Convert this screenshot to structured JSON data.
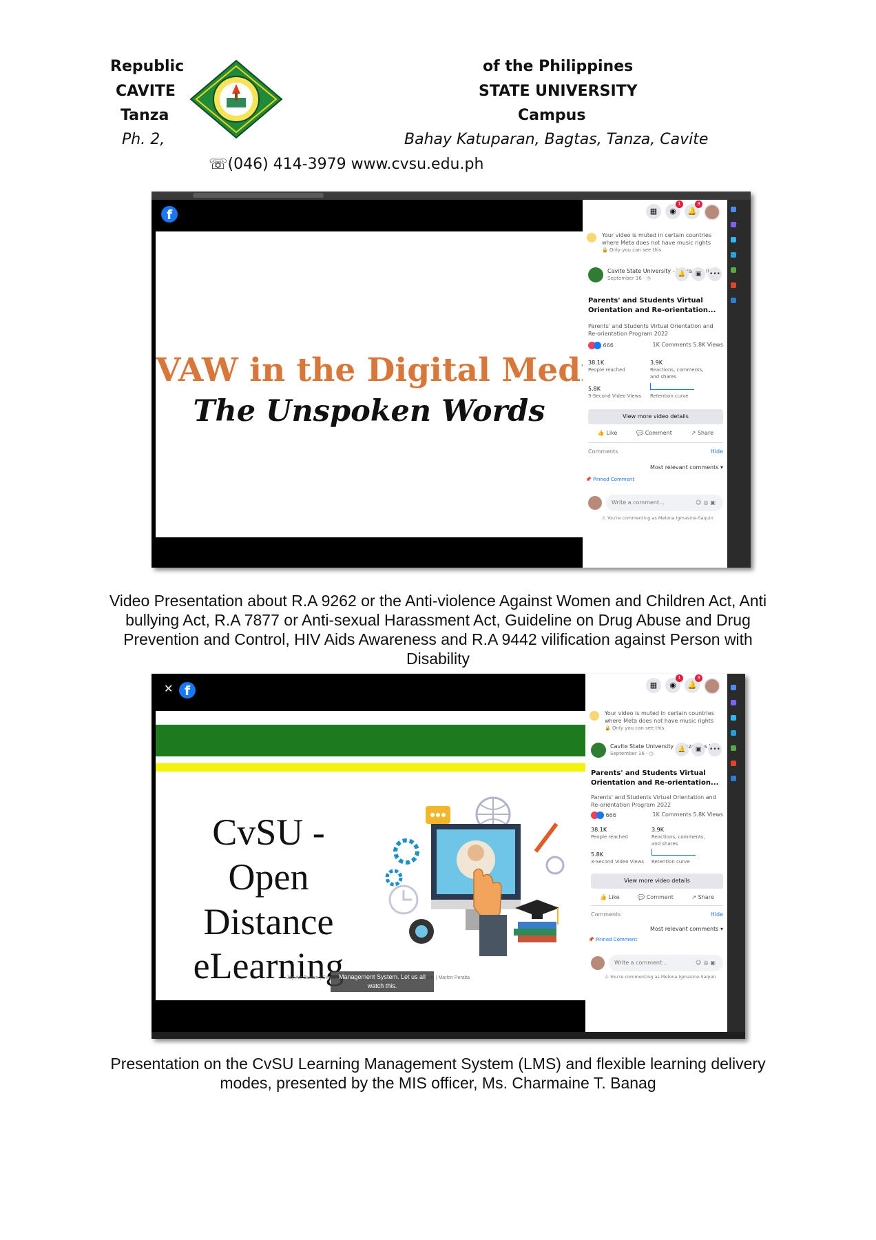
{
  "letterhead": {
    "left": [
      "Republic",
      "CAVITE",
      "Tanza",
      "Ph. 2,"
    ],
    "right": [
      "of the Philippines",
      "STATE UNIVERSITY",
      "Campus",
      "Bahay Katuparan, Bagtas, Tanza, Cavite"
    ],
    "contact": "☏(046) 414-3979 www.cvsu.edu.ph"
  },
  "colors": {
    "facebook_blue": "#1877f2",
    "vaw_orange": "#d9773a",
    "odl_green": "#1e7a1e",
    "odl_yellow": "#f2f20a",
    "seal_green": "#1f8a3a"
  },
  "fb_panel": {
    "notice": "Your video is muted in certain countries where Meta does not have music rights",
    "notice_sub": "🔒 Only you can see this",
    "page_name": "Cavite State University - Tanza was live.",
    "page_date": "September 16 · ◷",
    "title": "Parents' and Students Virtual Orientation and Re-orientation...",
    "description": "Parents' and Students Virtual Orientation and Re-orientation Program 2022",
    "reaction_count": "666",
    "comments_views": "1K Comments  5.8K Views",
    "stats": [
      {
        "value": "38.1K",
        "label": "People reached"
      },
      {
        "value": "3.9K",
        "label": "Reactions, comments, and shares"
      },
      {
        "value": "5.8K",
        "label": "3-Second Video Views"
      },
      {
        "value": "",
        "label": "Retention curve"
      }
    ],
    "view_more": "View more video details",
    "actions": [
      "👍 Like",
      "💬 Comment",
      "↗ Share"
    ],
    "comments_label": "Comments",
    "hide_label": "Hide",
    "sort_label": "Most relevant comments ▾",
    "pinned_label": "📌 Pinned Comment",
    "write_placeholder": "Write a comment...",
    "commenting_as": "⚠ You're commenting as Melona Igmasine-Saquin",
    "badge_values": [
      "1",
      "3"
    ]
  },
  "slide1": {
    "title": "VAW in the Digital Media",
    "subtitle": "The Unspoken Words"
  },
  "caption1": "Video Presentation about R.A 9262 or the Anti-violence Against Women and Children Act, Anti bullying Act, R.A 7877 or Anti-sexual Harassment Act, Guideline on Drug Abuse and Drug Prevention and Control, HIV Aids Awareness and R.A 9442 vilification against Person with Disability",
  "slide2": {
    "line1": "CvSU -",
    "line2": "Open Distance",
    "line3": "eLearning",
    "names": "Jay-Arr Buhain | Simeon Daez | Julie Ann Lontoc | Ezra Marie Ramos | Marlon Peralta",
    "subtitle_line1": "Management System. Let us all",
    "subtitle_line2": "watch this."
  },
  "caption2": "Presentation on the CvSU Learning Management System (LMS) and flexible learning delivery modes, presented by the MIS officer, Ms. Charmaine T. Banag"
}
